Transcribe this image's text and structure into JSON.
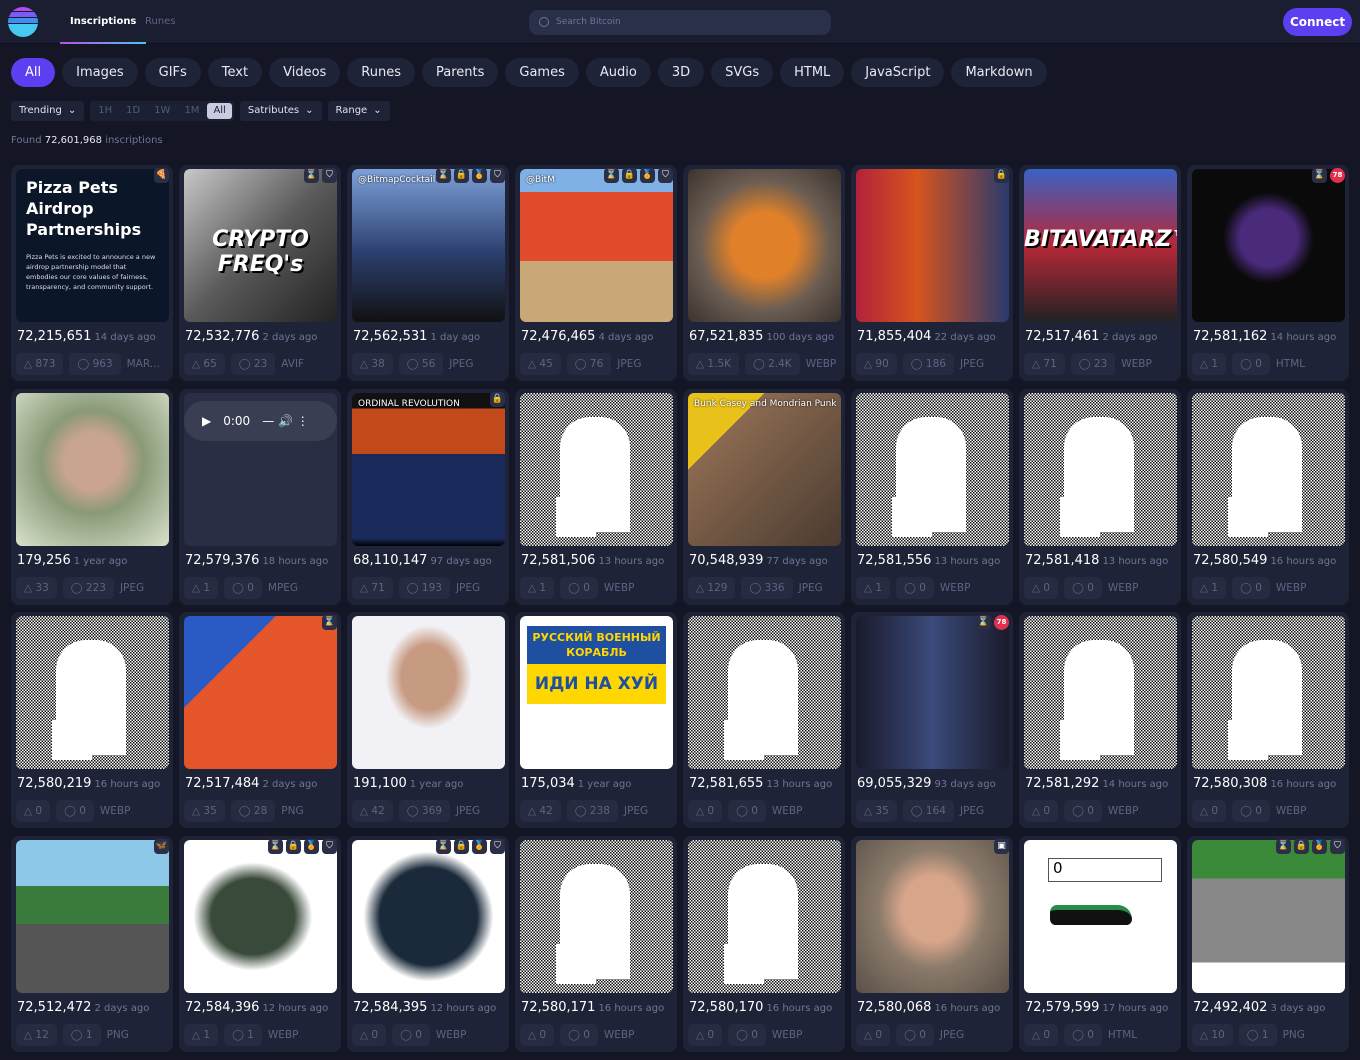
{
  "header": {
    "tabs": [
      {
        "label": "Inscriptions",
        "active": true
      },
      {
        "label": "Runes",
        "active": false
      }
    ],
    "search_placeholder": "Search Bitcoin",
    "connect_label": "Connect"
  },
  "categories": [
    "All",
    "Images",
    "GIFs",
    "Text",
    "Videos",
    "Runes",
    "Parents",
    "Games",
    "Audio",
    "3D",
    "SVGs",
    "HTML",
    "JavaScript",
    "Markdown"
  ],
  "active_category": "All",
  "filters": {
    "sort": "Trending",
    "time_ranges": [
      "1H",
      "1D",
      "1W",
      "1M",
      "All"
    ],
    "active_time": "All",
    "satributes": "Satributes",
    "range": "Range"
  },
  "found": {
    "prefix": "Found",
    "count": "72,601,968",
    "suffix": "inscriptions"
  },
  "colors": {
    "accent": "#5b3ff0",
    "background": "#141625",
    "card": "#1f2337"
  },
  "cards": [
    {
      "id": "72,215,651",
      "age": "14 days ago",
      "likes": "873",
      "comments": "963",
      "type": "MAR...",
      "thumb": {
        "kind": "pizza",
        "title": "Pizza Pets Airdrop Partnerships",
        "body": "Pizza Pets is excited to announce a new airdrop partnership model that embodies our core values of fairness, transparency, and community support."
      },
      "badges": [
        "pizza-icon"
      ]
    },
    {
      "id": "72,532,776",
      "age": "2 days ago",
      "likes": "65",
      "comments": "23",
      "type": "AVIF",
      "thumb": {
        "kind": "photo",
        "bg": "linear-gradient(135deg,#c8c8c8,#5a5a5a,#222)",
        "text": "CRYPTO FREQ's"
      },
      "badges": [
        "hourglass-icon",
        "shield-icon"
      ]
    },
    {
      "id": "72,562,531",
      "age": "1 day ago",
      "likes": "38",
      "comments": "56",
      "type": "JPEG",
      "thumb": {
        "kind": "photo",
        "bg": "linear-gradient(180deg,#7da0d8,#2b3f6e 55%,#111)",
        "caption": "@BitmapCocktail"
      },
      "badges": [
        "hourglass-icon",
        "lock-icon",
        "medal-icon",
        "shield-icon"
      ]
    },
    {
      "id": "72,476,465",
      "age": "4 days ago",
      "likes": "45",
      "comments": "76",
      "type": "JPEG",
      "thumb": {
        "kind": "photo",
        "bg": "linear-gradient(180deg,#7fb0e6 0 15%,#e14a2a 15% 60%,#c9a878 60%)",
        "caption": "@BitM"
      },
      "badges": [
        "hourglass-icon",
        "lock-icon",
        "medal-icon",
        "shield-icon"
      ]
    },
    {
      "id": "67,521,835",
      "age": "100 days ago",
      "likes": "1.5K",
      "comments": "2.4K",
      "type": "WEBP",
      "thumb": {
        "kind": "photo",
        "bg": "radial-gradient(circle at 50% 50%,#e0812a 0 30%,#6b5d52 60%,#3a332e)"
      },
      "badges": []
    },
    {
      "id": "71,855,404",
      "age": "22 days ago",
      "likes": "90",
      "comments": "186",
      "type": "JPEG",
      "thumb": {
        "kind": "photo",
        "bg": "linear-gradient(90deg,#b3213a,#d6541e 40%,#2a3a6e)"
      },
      "badges": [
        "lock-icon"
      ]
    },
    {
      "id": "72,517,461",
      "age": "2 days ago",
      "likes": "71",
      "comments": "23",
      "type": "WEBP",
      "thumb": {
        "kind": "photo",
        "bg": "linear-gradient(180deg,#3a62c4,#b62838 50%,#222)",
        "text": "BITAVATARZ™"
      },
      "badges": []
    },
    {
      "id": "72,581,162",
      "age": "14 hours ago",
      "likes": "1",
      "comments": "0",
      "type": "HTML",
      "thumb": {
        "kind": "photo",
        "bg": "radial-gradient(circle at 50% 45%,#4a2a7a 0 25%,#0a0a0a 40%)"
      },
      "badges": [
        "hourglass-icon",
        "78"
      ]
    },
    {
      "id": "179,256",
      "age": "1 year ago",
      "likes": "33",
      "comments": "223",
      "type": "JPEG",
      "thumb": {
        "kind": "photo",
        "bg": "radial-gradient(circle at 50% 45%,#c9a48e 0 25%,#8a9a78 45%,#d9e2cc)"
      },
      "badges": []
    },
    {
      "id": "72,579,376",
      "age": "18 hours ago",
      "likes": "1",
      "comments": "0",
      "type": "MPEG",
      "thumb": {
        "kind": "video",
        "time": "0:00"
      },
      "badges": []
    },
    {
      "id": "68,110,147",
      "age": "97 days ago",
      "likes": "71",
      "comments": "193",
      "type": "JPEG",
      "thumb": {
        "kind": "photo",
        "bg": "linear-gradient(180deg,#111 0 10%,#c24a1a 10% 40%,#1a2a5a 40% 95%,#000)",
        "caption": "ORDINAL REVOLUTION"
      },
      "badges": [
        "lock-icon"
      ]
    },
    {
      "id": "72,581,506",
      "age": "13 hours ago",
      "likes": "1",
      "comments": "0",
      "type": "WEBP",
      "thumb": {
        "kind": "noise"
      },
      "badges": []
    },
    {
      "id": "70,548,939",
      "age": "77 days ago",
      "likes": "129",
      "comments": "336",
      "type": "JPEG",
      "thumb": {
        "kind": "photo",
        "bg": "linear-gradient(135deg,#e8c21a 0 25%,#8a6a50 25%,#4a3a30)",
        "caption": "Bunk Casey and Mondrian Punk"
      },
      "badges": []
    },
    {
      "id": "72,581,556",
      "age": "13 hours ago",
      "likes": "1",
      "comments": "0",
      "type": "WEBP",
      "thumb": {
        "kind": "noise"
      },
      "badges": []
    },
    {
      "id": "72,581,418",
      "age": "13 hours ago",
      "likes": "0",
      "comments": "0",
      "type": "WEBP",
      "thumb": {
        "kind": "noise"
      },
      "badges": []
    },
    {
      "id": "72,580,549",
      "age": "16 hours ago",
      "likes": "1",
      "comments": "0",
      "type": "WEBP",
      "thumb": {
        "kind": "noise"
      },
      "badges": []
    },
    {
      "id": "72,580,219",
      "age": "16 hours ago",
      "likes": "0",
      "comments": "0",
      "type": "WEBP",
      "thumb": {
        "kind": "noise"
      },
      "badges": []
    },
    {
      "id": "72,517,484",
      "age": "2 days ago",
      "likes": "35",
      "comments": "28",
      "type": "PNG",
      "thumb": {
        "kind": "photo",
        "bg": "linear-gradient(135deg,#2a5ac4 0 30%,#e4552a 30% 100%)"
      },
      "badges": [
        "hourglass-icon"
      ]
    },
    {
      "id": "191,100",
      "age": "1 year ago",
      "likes": "42",
      "comments": "369",
      "type": "JPEG",
      "thumb": {
        "kind": "photo",
        "bg": "radial-gradient(ellipse at 50% 40%,#c79a82 0 25%,#f2f2f6 40%)"
      },
      "badges": []
    },
    {
      "id": "175,034",
      "age": "1 year ago",
      "likes": "42",
      "comments": "238",
      "type": "JPEG",
      "thumb": {
        "kind": "ship",
        "line1": "РУССКИЙ ВОЕННЫЙ КОРАБЛЬ",
        "line2": "ИДИ НА ХУЙ"
      },
      "badges": []
    },
    {
      "id": "72,581,655",
      "age": "13 hours ago",
      "likes": "0",
      "comments": "0",
      "type": "WEBP",
      "thumb": {
        "kind": "noise"
      },
      "badges": []
    },
    {
      "id": "69,055,329",
      "age": "93 days ago",
      "likes": "35",
      "comments": "164",
      "type": "JPEG",
      "thumb": {
        "kind": "photo",
        "bg": "linear-gradient(90deg,#1a1a2a,#3a4a7a 50%,#1a1a2a)"
      },
      "badges": [
        "hourglass-icon",
        "78"
      ]
    },
    {
      "id": "72,581,292",
      "age": "14 hours ago",
      "likes": "0",
      "comments": "0",
      "type": "WEBP",
      "thumb": {
        "kind": "noise"
      },
      "badges": []
    },
    {
      "id": "72,580,308",
      "age": "16 hours ago",
      "likes": "0",
      "comments": "0",
      "type": "WEBP",
      "thumb": {
        "kind": "noise"
      },
      "badges": []
    },
    {
      "id": "72,512,472",
      "age": "2 days ago",
      "likes": "12",
      "comments": "1",
      "type": "PNG",
      "thumb": {
        "kind": "photo",
        "bg": "linear-gradient(180deg,#8ec8e8 0 30%,#3a7a3a 30% 55%,#555 55%)"
      },
      "badges": [
        "butterfly-icon"
      ]
    },
    {
      "id": "72,584,396",
      "age": "12 hours ago",
      "likes": "1",
      "comments": "1",
      "type": "WEBP",
      "thumb": {
        "kind": "photo",
        "bg": "radial-gradient(ellipse at 45% 50%,#3a4a3a 0 35%,#fff 50%)"
      },
      "badges": [
        "hourglass-icon",
        "lock-icon",
        "medal-icon",
        "shield-icon"
      ]
    },
    {
      "id": "72,584,395",
      "age": "12 hours ago",
      "likes": "0",
      "comments": "0",
      "type": "WEBP",
      "thumb": {
        "kind": "photo",
        "bg": "radial-gradient(ellipse at 50% 50%,#1a2a3a 0 45%,#fff 60%)"
      },
      "badges": [
        "hourglass-icon",
        "lock-icon",
        "medal-icon",
        "shield-icon"
      ]
    },
    {
      "id": "72,580,171",
      "age": "16 hours ago",
      "likes": "0",
      "comments": "0",
      "type": "WEBP",
      "thumb": {
        "kind": "noise"
      },
      "badges": []
    },
    {
      "id": "72,580,170",
      "age": "16 hours ago",
      "likes": "0",
      "comments": "0",
      "type": "WEBP",
      "thumb": {
        "kind": "noise"
      },
      "badges": []
    },
    {
      "id": "72,580,068",
      "age": "16 hours ago",
      "likes": "0",
      "comments": "0",
      "type": "JPEG",
      "thumb": {
        "kind": "photo",
        "bg": "radial-gradient(ellipse at 50% 45%,#d7a58a 0 28%,#8a7a6a 50%,#5a5048)"
      },
      "badges": [
        "square-icon"
      ]
    },
    {
      "id": "72,579,599",
      "age": "17 hours ago",
      "likes": "0",
      "comments": "0",
      "type": "HTML",
      "thumb": {
        "kind": "html",
        "value": "0"
      },
      "badges": []
    },
    {
      "id": "72,492,402",
      "age": "3 days ago",
      "likes": "10",
      "comments": "1",
      "type": "PNG",
      "thumb": {
        "kind": "photo",
        "bg": "linear-gradient(180deg,#3a8a3a 0 25%,#888 25% 80%,#fff 80%)"
      },
      "badges": [
        "hourglass-icon",
        "lock-icon",
        "medal-icon",
        "shield-icon"
      ]
    }
  ]
}
